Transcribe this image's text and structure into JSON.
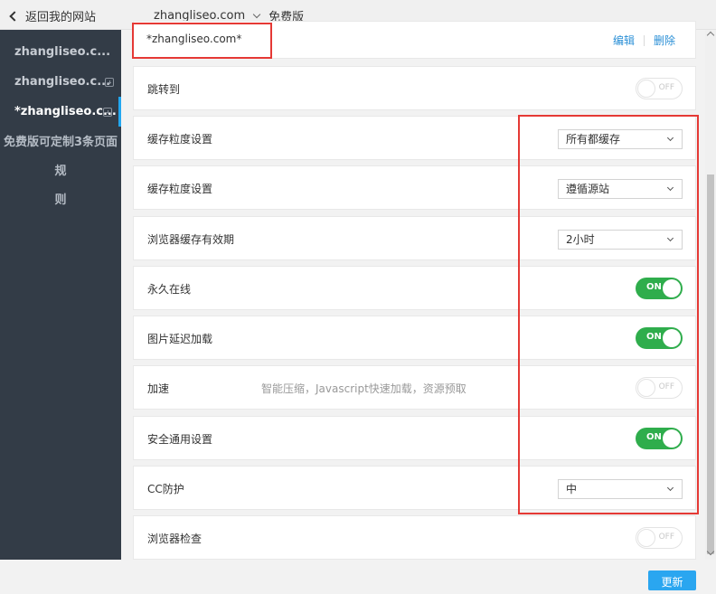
{
  "topbar": {
    "back_label": "返回我的网站",
    "domain": "zhangliseo.com",
    "plan": "免费版"
  },
  "sidebar": {
    "items": [
      {
        "label": "zhangliseo.c..."
      },
      {
        "label": "zhangliseo.c..."
      },
      {
        "label": "*zhangliseo.c..."
      }
    ],
    "note_line1": "免费版可定制3条页面规",
    "note_line2": "则"
  },
  "header": {
    "title": "*zhangliseo.com*",
    "edit_label": "编辑",
    "delete_label": "删除"
  },
  "rows": {
    "redirect": {
      "label": "跳转到",
      "toggle": "OFF"
    },
    "cache_granularity_1": {
      "label": "缓存粒度设置",
      "value": "所有都缓存"
    },
    "cache_granularity_2": {
      "label": "缓存粒度设置",
      "value": "遵循源站"
    },
    "browser_cache_ttl": {
      "label": "浏览器缓存有效期",
      "value": "2小时"
    },
    "always_online": {
      "label": "永久在线",
      "toggle": "ON"
    },
    "image_lazy_load": {
      "label": "图片延迟加载",
      "toggle": "ON"
    },
    "speed_up": {
      "label": "加速",
      "hint": "智能压缩，Javascript快速加载，资源预取",
      "toggle": "OFF"
    },
    "security": {
      "label": "安全通用设置",
      "toggle": "ON"
    },
    "cc_protection": {
      "label": "CC防护",
      "value": "中"
    },
    "browser_check": {
      "label": "浏览器检查",
      "toggle": "OFF"
    }
  },
  "footer": {
    "update_label": "更新"
  },
  "colors": {
    "accent": "#2aa6f0",
    "toggle_on": "#2fad4c",
    "annotation_red": "#e53935",
    "sidebar_bg": "#333c47"
  }
}
